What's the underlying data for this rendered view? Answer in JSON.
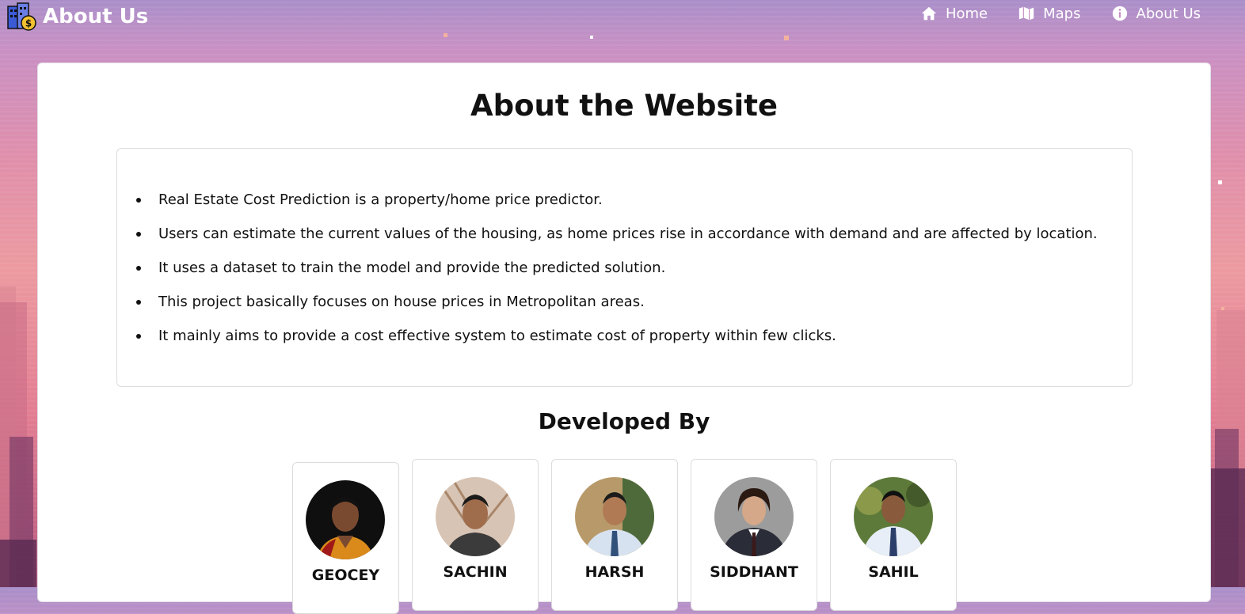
{
  "header": {
    "title": "About Us",
    "logo_icon": "real-estate-coin-icon",
    "nav": [
      {
        "label": "Home",
        "icon": "home-icon"
      },
      {
        "label": "Maps",
        "icon": "map-icon"
      },
      {
        "label": "About Us",
        "icon": "info-icon"
      }
    ]
  },
  "main": {
    "title": "About the Website",
    "points": [
      "Real Estate Cost Prediction is a property/home price predictor.",
      "Users can estimate the current values of the housing, as home prices rise in accordance with demand and are affected by location.",
      "It uses a dataset to train the model and provide the predicted solution.",
      "This project basically focuses on house prices in Metropolitan areas.",
      "It mainly aims to provide a cost effective system to estimate cost of property within few clicks."
    ],
    "developed_by_title": "Developed By",
    "developers": [
      {
        "first_name": "GEOCEY"
      },
      {
        "first_name": "SACHIN"
      },
      {
        "first_name": "HARSH"
      },
      {
        "first_name": "SIDDHANT"
      },
      {
        "first_name": "SAHIL"
      }
    ]
  },
  "colors": {
    "brand_text": "#ffffff",
    "card_bg": "#ffffff",
    "sky_top": "#a98fc9",
    "sky_bottom": "#b85b7f"
  }
}
